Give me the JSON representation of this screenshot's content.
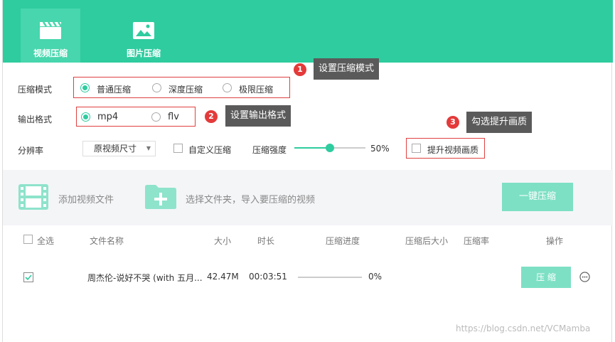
{
  "tabs": [
    {
      "label": "视频压缩",
      "icon": "clapperboard-icon",
      "active": true
    },
    {
      "label": "图片压缩",
      "icon": "image-icon",
      "active": false
    }
  ],
  "compress_mode": {
    "label": "压缩模式",
    "options": [
      "普通压缩",
      "深度压缩",
      "极限压缩"
    ],
    "selected": "普通压缩"
  },
  "output_format": {
    "label": "输出格式",
    "options": [
      "mp4",
      "flv"
    ],
    "selected": "mp4"
  },
  "resolution": {
    "label": "分辨率",
    "value": "原视频尺寸",
    "custom_label": "自定义压缩",
    "strength_label": "压缩强度",
    "strength_value": "50%",
    "strength_fraction": 0.5,
    "quality_label": "提升视频画质"
  },
  "annotations": [
    {
      "number": "1",
      "text": "设置压缩模式"
    },
    {
      "number": "2",
      "text": "设置输出格式"
    },
    {
      "number": "3",
      "text": "勾选提升画质"
    }
  ],
  "toolbar": {
    "add_file": "添加视频文件",
    "select_folder": "选择文件夹，导入要压缩的视频",
    "compress_all": "一键压缩"
  },
  "table": {
    "columns": [
      "全选",
      "文件名称",
      "大小",
      "时长",
      "压缩进度",
      "压缩后大小",
      "压缩率",
      "操作"
    ],
    "rows": [
      {
        "checked": true,
        "name": "周杰伦-说好不哭 (with 五月...",
        "size": "42.47M",
        "duration": "00:03:51",
        "progress": "0%",
        "progress_fraction": 0,
        "action": "压 缩"
      }
    ]
  },
  "watermark": "https://blog.csdn.net/VCMamba",
  "colors": {
    "brand": "#2ecc9f",
    "brand_light": "#7de0c4",
    "annotation_red": "#e43a3a",
    "tooltip": "#5a5a5a"
  }
}
